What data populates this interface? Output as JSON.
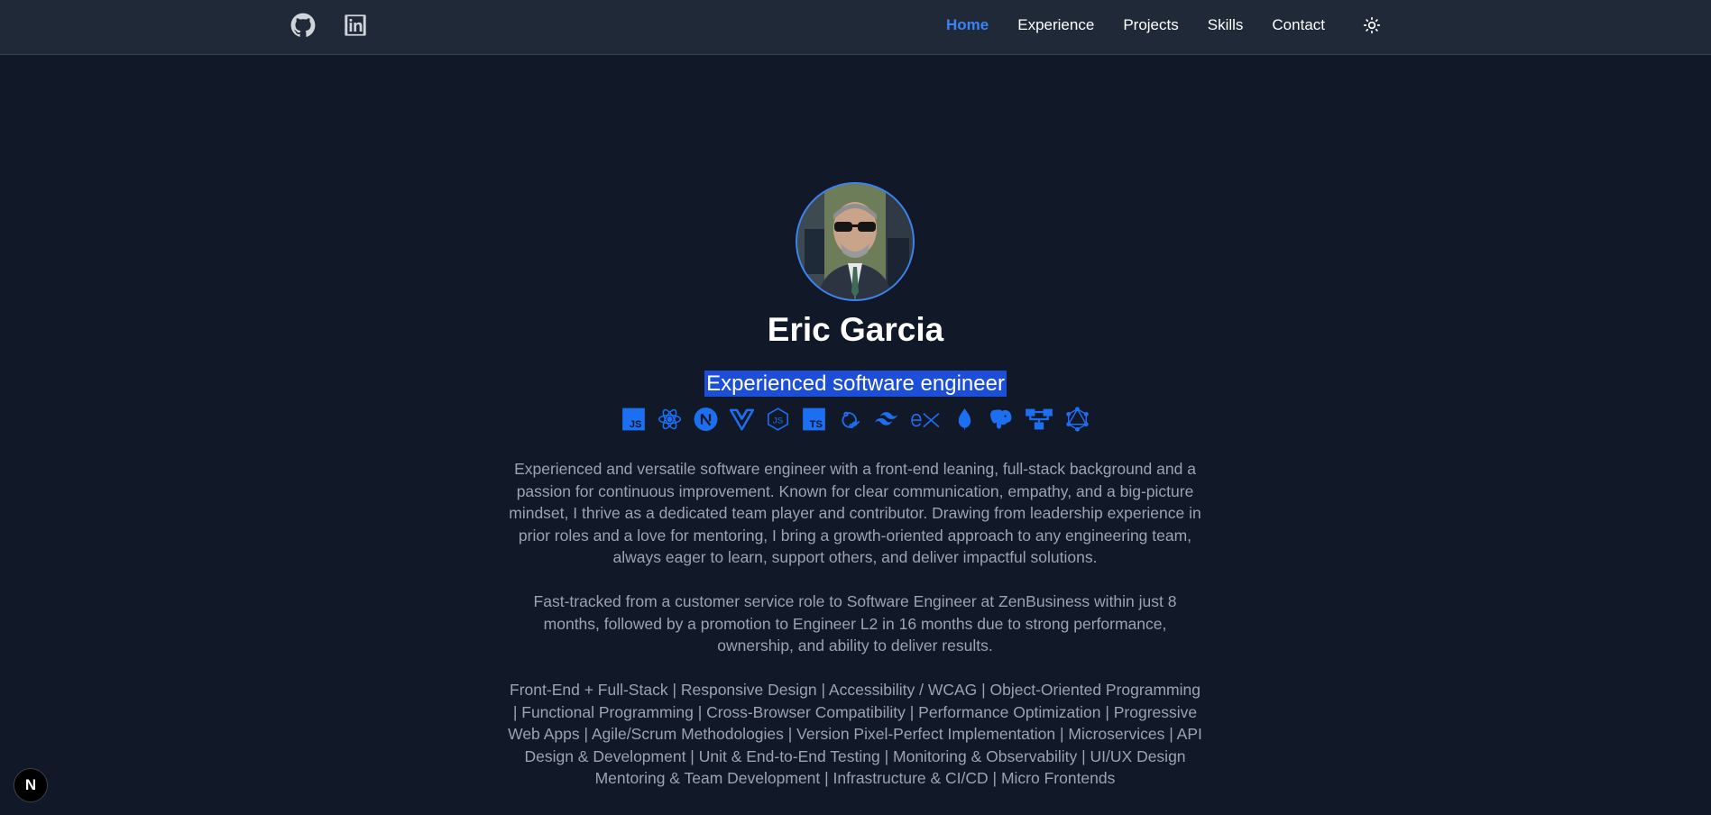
{
  "nav": {
    "social": [
      {
        "icon": "github-icon"
      },
      {
        "icon": "linkedin-icon"
      }
    ],
    "links": [
      {
        "label": "Home",
        "active": true
      },
      {
        "label": "Experience",
        "active": false
      },
      {
        "label": "Projects",
        "active": false
      },
      {
        "label": "Skills",
        "active": false
      },
      {
        "label": "Contact",
        "active": false
      }
    ],
    "theme_icon": "sun-icon"
  },
  "profile": {
    "name": "Eric Garcia",
    "subtitle": "Experienced software engineer"
  },
  "tech_icons": [
    "javascript-icon",
    "react-icon",
    "nextjs-icon",
    "vue-icon",
    "nodejs-icon",
    "typescript-icon",
    "redux-icon",
    "tailwind-icon",
    "express-icon",
    "mongodb-icon",
    "postgresql-icon",
    "sitemap-icon",
    "graphql-icon"
  ],
  "bio": {
    "p1": "Experienced and versatile software engineer with a front-end leaning, full-stack background and a passion for continuous improvement. Known for clear communication, empathy, and a big-picture mindset, I thrive as a dedicated team player and contributor. Drawing from leadership experience in prior roles and a love for mentoring, I bring a growth-oriented approach to any engineering team, always eager to learn, support others, and deliver impactful solutions.",
    "p2": "Fast-tracked from a customer service role to Software Engineer at ZenBusiness within just 8 months, followed by a promotion to Engineer L2 in 16 months due to strong performance, ownership, and ability to deliver results.",
    "p3": "Front-End + Full-Stack | Responsive Design | Accessibility / WCAG | Object-Oriented Programming | Functional Programming | Cross-Browser Compatibility | Performance Optimization | Progressive Web Apps | Agile/Scrum Methodologies | Version Pixel-Perfect Implementation | Microservices | API Design & Development | Unit & End-to-End Testing | Monitoring & Observability | UI/UX Design Mentoring & Team Development | Infrastructure & CI/CD | Micro Frontends"
  },
  "badge": {
    "label": "N"
  },
  "colors": {
    "background": "#111827",
    "nav": "#1f2937",
    "accent": "#3b82f6",
    "icon_blue": "#1d6ff2",
    "text_muted": "#9ca3af",
    "highlight": "#1d4ed8"
  }
}
